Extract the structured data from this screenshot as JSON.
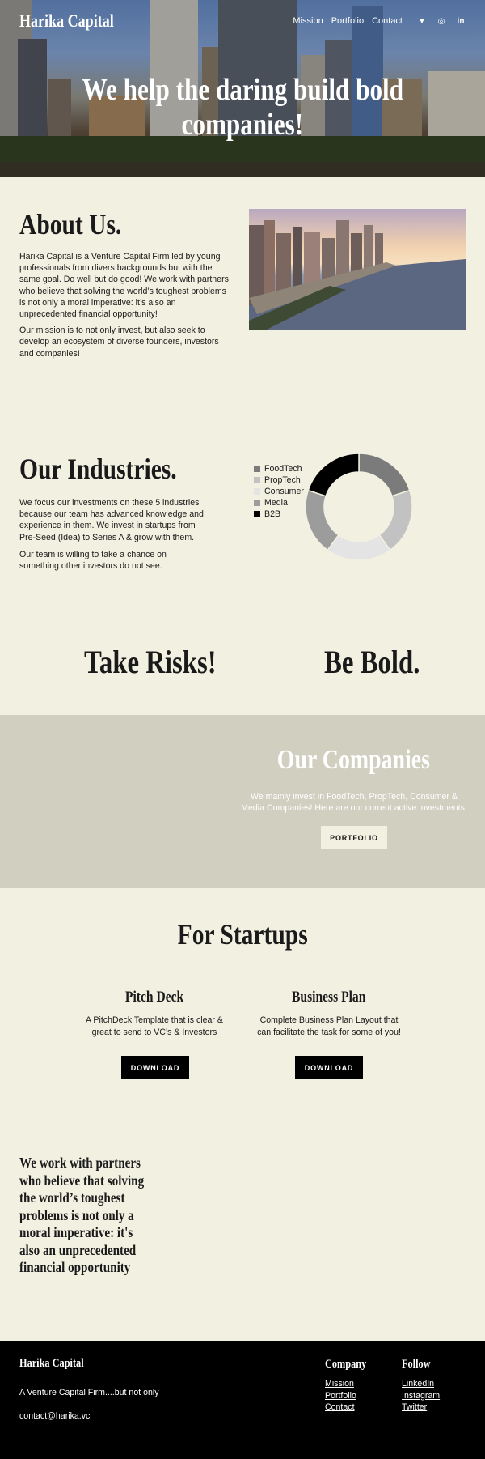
{
  "header": {
    "brand": "Harika Capital",
    "nav": [
      "Mission",
      "Portfolio",
      "Contact"
    ],
    "social_icons": [
      "twitter-icon",
      "instagram-icon",
      "linkedin-icon"
    ]
  },
  "hero": {
    "title_line1": "We help the daring build bold",
    "title_line2": "companies!"
  },
  "about": {
    "title": "About Us.",
    "p1": "Harika Capital is a Venture Capital Firm led by young professionals from divers backgrounds but with the same goal. Do well but do good! We work with partners who believe that solving the world’s toughest problems is not only a moral imperative: it’s also an unprecedented financial opportunity!",
    "p2": "Our mission is to not only invest, but also seek to develop an ecosystem of diverse founders, investors and companies!"
  },
  "industries": {
    "title": "Our Industries.",
    "p1": "We focus our investments on these 5 industries because our team has advanced knowledge and experience in them. We invest in startups from Pre-Seed (Idea) to Series A & grow with them.",
    "p2": "Our team is willing to take a chance on something other investors do not see."
  },
  "chart_data": {
    "type": "pie",
    "categories": [
      "FoodTech",
      "PropTech",
      "Consumer",
      "Media",
      "B2B"
    ],
    "values": [
      20,
      20,
      20,
      20,
      20
    ],
    "colors": [
      "#7b7b7b",
      "#c2c2c2",
      "#e4e4e4",
      "#9c9c9c",
      "#000000"
    ],
    "legend_position": "left"
  },
  "risks": {
    "left": "Take Risks!",
    "right": "Be Bold."
  },
  "companies": {
    "title": "Our Companies",
    "text": "We mainly invest in FoodTech, PropTech, Consumer & Media Companies! Here are our current active investments.",
    "button": "PORTFOLIO"
  },
  "startups": {
    "title": "For Startups",
    "cols": [
      {
        "title": "Pitch Deck",
        "text": "A PitchDeck Template that is clear & great to send to VC’s & Investors",
        "button": "DOWNLOAD"
      },
      {
        "title": "Business Plan",
        "text": "Complete Business Plan Layout that can facilitate the task for some of you!",
        "button": "DOWNLOAD"
      }
    ]
  },
  "quote": {
    "text": "We work with partners who believe that solving the world’s toughest problems is not only a moral imperative: it's also an unprecedented financial opportunity"
  },
  "footer": {
    "brand": "Harika Capital",
    "tagline": "A Venture Capital Firm....but not only",
    "email": "contact@harika.vc",
    "company_title": "Company",
    "company_links": [
      "Mission",
      "Portfolio",
      "Contact"
    ],
    "follow_title": "Follow",
    "follow_links": [
      "LinkedIn",
      "Instagram",
      "Twitter"
    ]
  }
}
